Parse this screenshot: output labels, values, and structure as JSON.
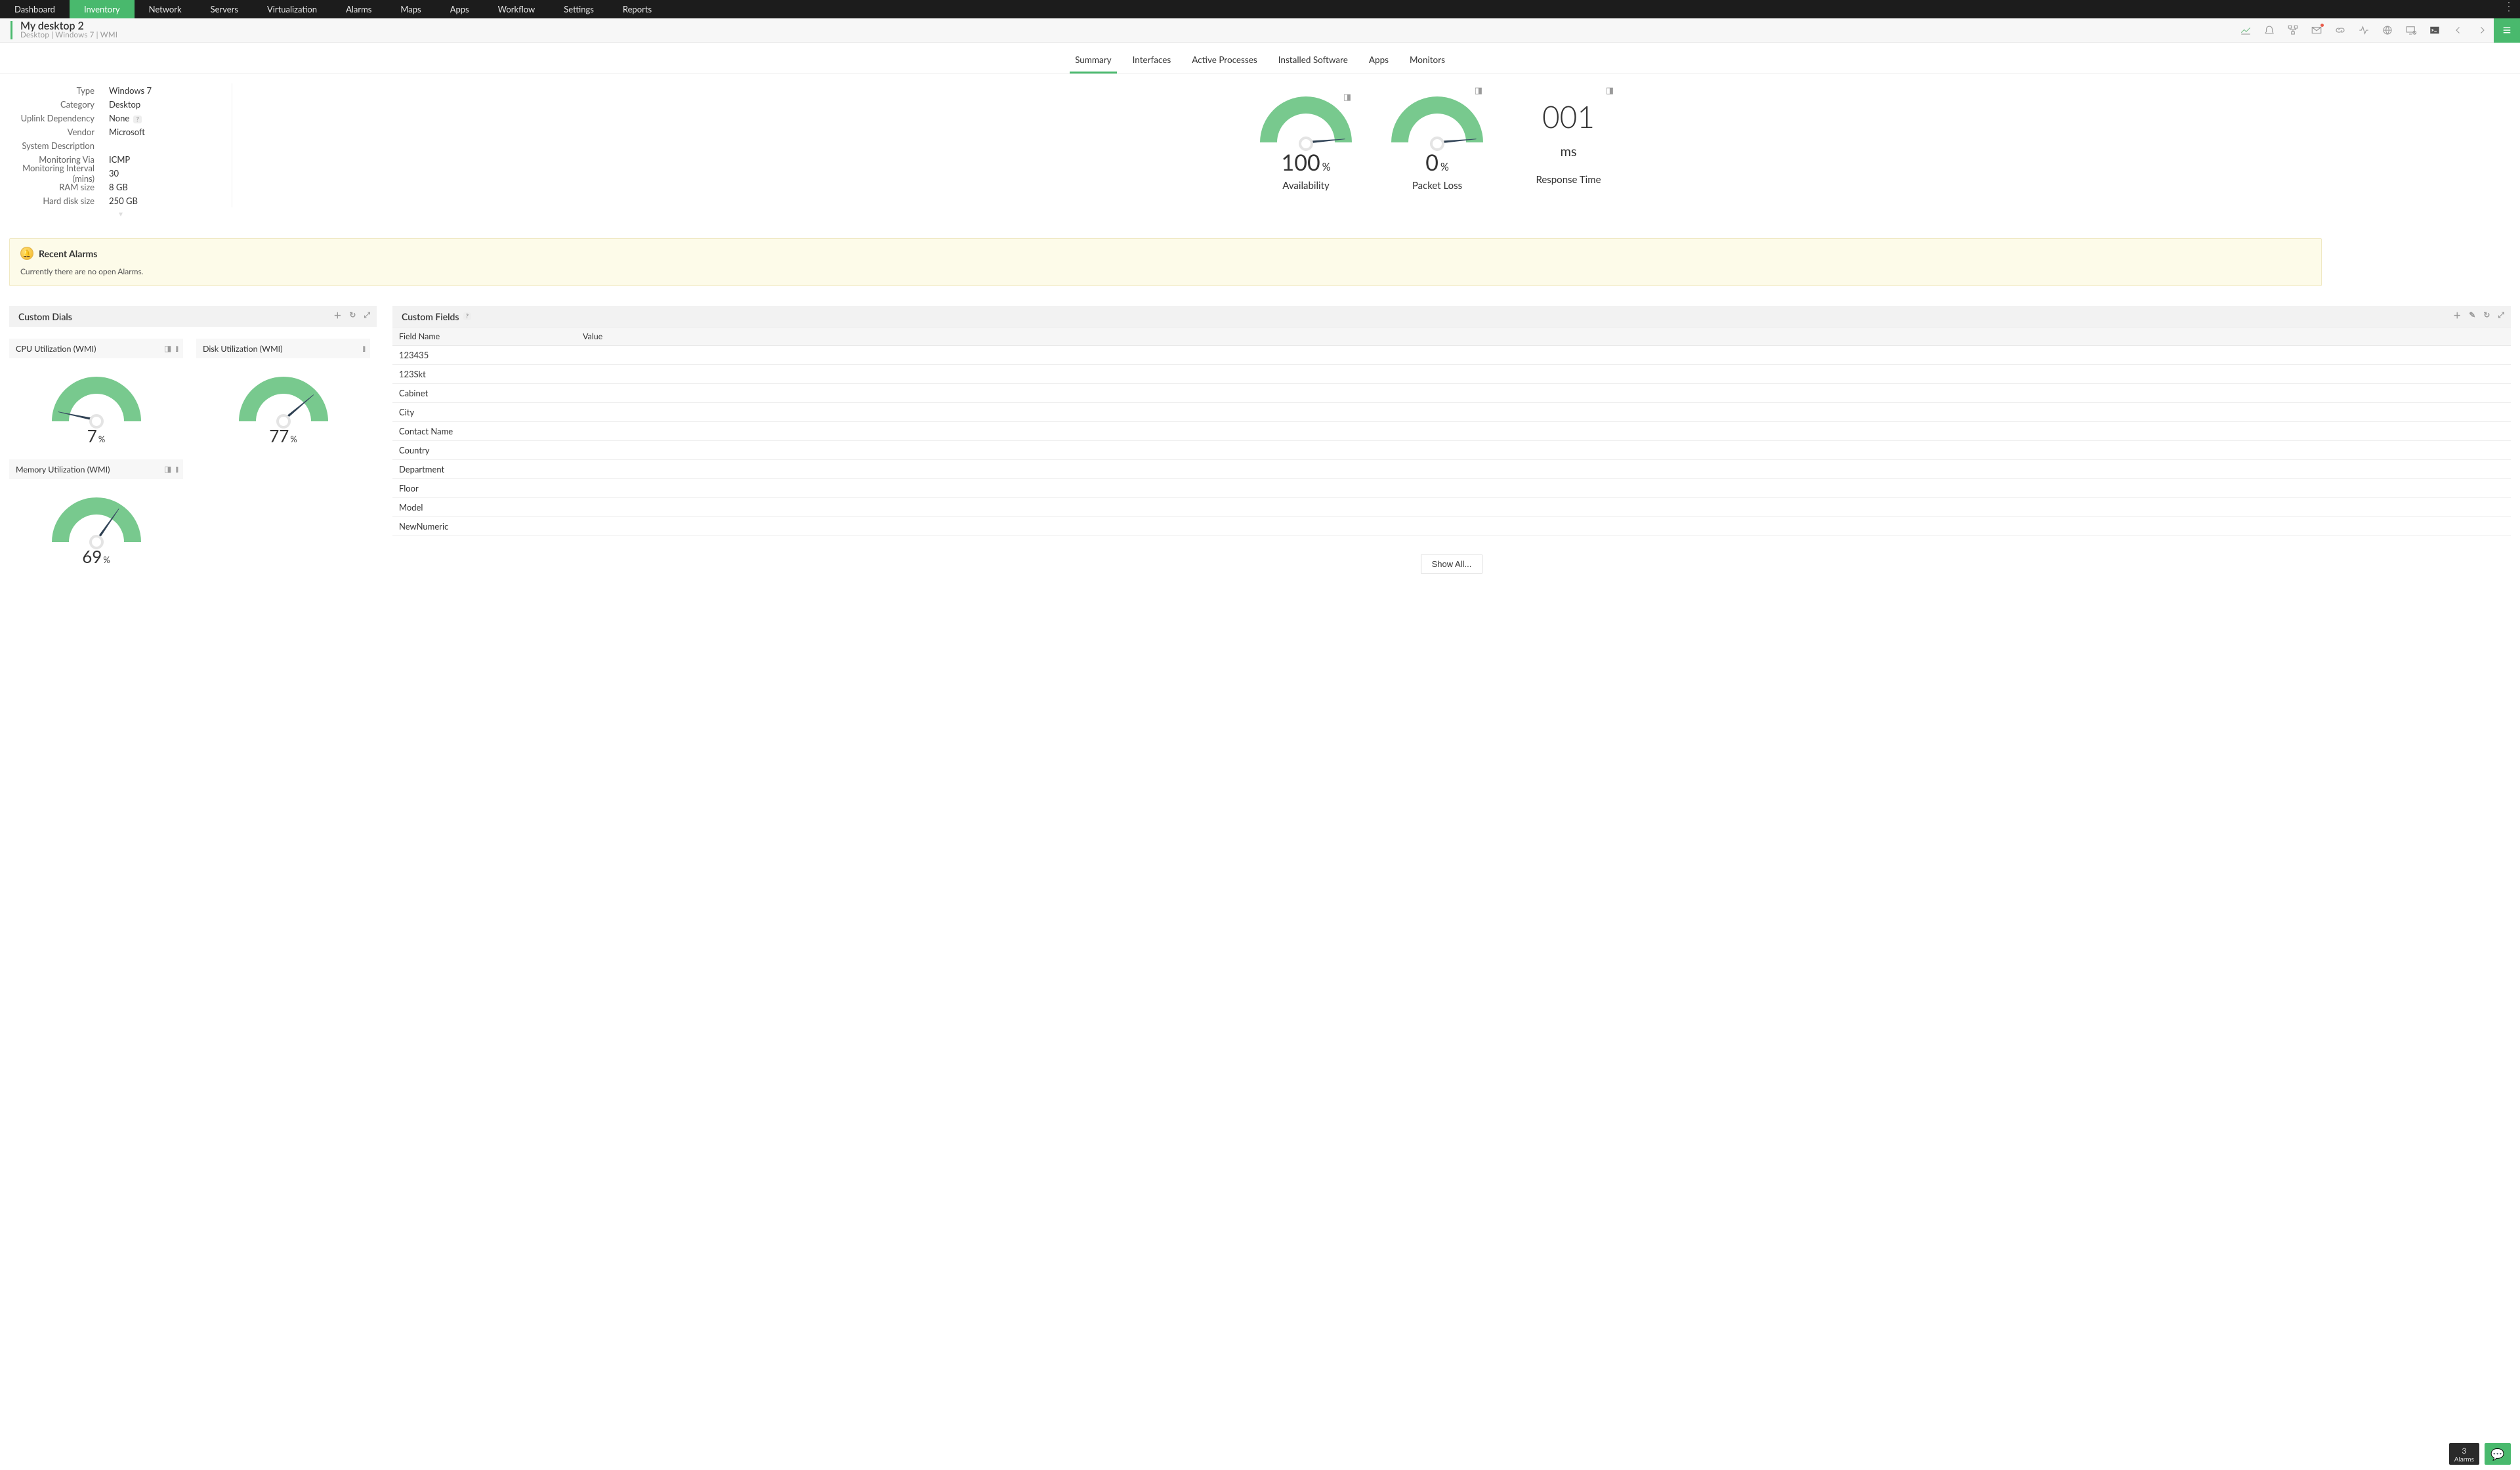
{
  "nav": {
    "items": [
      "Dashboard",
      "Inventory",
      "Network",
      "Servers",
      "Virtualization",
      "Alarms",
      "Maps",
      "Apps",
      "Workflow",
      "Settings",
      "Reports"
    ],
    "active_index": 1
  },
  "device": {
    "title": "My desktop 2",
    "meta": "Desktop  | Windows 7  | WMI"
  },
  "tabs": {
    "items": [
      "Summary",
      "Interfaces",
      "Active Processes",
      "Installed Software",
      "Apps",
      "Monitors"
    ],
    "active_index": 0
  },
  "info": {
    "rows": [
      {
        "k": "Type",
        "v": "Windows 7"
      },
      {
        "k": "Category",
        "v": "Desktop"
      },
      {
        "k": "Uplink Dependency",
        "v": "None",
        "help": true
      },
      {
        "k": "Vendor",
        "v": "Microsoft"
      },
      {
        "k": "System Description",
        "v": ""
      },
      {
        "k": "Monitoring Via",
        "v": "ICMP"
      },
      {
        "k": "Monitoring Interval (mins)",
        "v": "30"
      },
      {
        "k": "RAM size",
        "v": "8 GB"
      },
      {
        "k": "Hard disk size",
        "v": "250 GB"
      }
    ]
  },
  "gauges": {
    "availability": {
      "value": "100",
      "unit": "%",
      "label": "Availability",
      "angle": -5
    },
    "packetloss": {
      "value": "0",
      "unit": "%",
      "label": "Packet Loss",
      "angle": -5
    },
    "response": {
      "value": "001",
      "unit": "ms",
      "label": "Response Time"
    }
  },
  "alarms": {
    "title": "Recent Alarms",
    "message": "Currently there are no open Alarms."
  },
  "customDials": {
    "title": "Custom Dials",
    "dials": [
      {
        "title": "CPU Utilization (WMI)",
        "value": "7",
        "angle": -168,
        "wmi_icon": true
      },
      {
        "title": "Disk Utilization (WMI)",
        "value": "77",
        "angle": -40,
        "wmi_icon": false
      },
      {
        "title": "Memory Utilization (WMI)",
        "value": "69",
        "angle": -55,
        "wmi_icon": true
      }
    ]
  },
  "customFields": {
    "title": "Custom Fields",
    "header": {
      "name": "Field Name",
      "value": "Value"
    },
    "rows": [
      {
        "name": "123435",
        "value": ""
      },
      {
        "name": "123Skt",
        "value": ""
      },
      {
        "name": "Cabinet",
        "value": ""
      },
      {
        "name": "City",
        "value": ""
      },
      {
        "name": "Contact Name",
        "value": ""
      },
      {
        "name": "Country",
        "value": ""
      },
      {
        "name": "Department",
        "value": ""
      },
      {
        "name": "Floor",
        "value": ""
      },
      {
        "name": "Model",
        "value": ""
      },
      {
        "name": "NewNumeric",
        "value": ""
      }
    ],
    "showall": "Show All..."
  },
  "bottom": {
    "count": "3",
    "label": "Alarms"
  },
  "chart_data": [
    {
      "type": "gauge",
      "title": "Availability",
      "value": 100,
      "unit": "%",
      "range": [
        0,
        100
      ]
    },
    {
      "type": "gauge",
      "title": "Packet Loss",
      "value": 0,
      "unit": "%",
      "range": [
        0,
        100
      ]
    },
    {
      "type": "metric",
      "title": "Response Time",
      "value": 1,
      "unit": "ms"
    },
    {
      "type": "gauge",
      "title": "CPU Utilization (WMI)",
      "value": 7,
      "unit": "%",
      "range": [
        0,
        100
      ]
    },
    {
      "type": "gauge",
      "title": "Disk Utilization (WMI)",
      "value": 77,
      "unit": "%",
      "range": [
        0,
        100
      ]
    },
    {
      "type": "gauge",
      "title": "Memory Utilization (WMI)",
      "value": 69,
      "unit": "%",
      "range": [
        0,
        100
      ]
    }
  ]
}
